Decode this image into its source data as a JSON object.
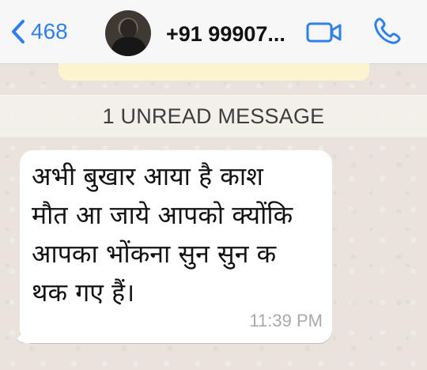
{
  "header": {
    "back_count": "468",
    "contact_name": "+91 99907..."
  },
  "conversation": {
    "unread_label": "1 UNREAD MESSAGE",
    "message": {
      "lines": [
        "अभी बुखार आया है काश",
        "मौत आ जाये आपको क्योंकि",
        "आपका भोंकना सुन सुन क",
        "थक गए हैं।"
      ],
      "time": "11:39 PM"
    }
  },
  "colors": {
    "accent": "#2f80ed",
    "header_background": "#f7f7f7",
    "chat_background": "#e9e3dc",
    "unread_background": "#f5f2ec",
    "bubble_background": "#ffffff",
    "time_text": "#a9a9a9"
  },
  "icons": {
    "back": "chevron-left-icon",
    "video": "video-camera-icon",
    "call": "phone-icon"
  }
}
